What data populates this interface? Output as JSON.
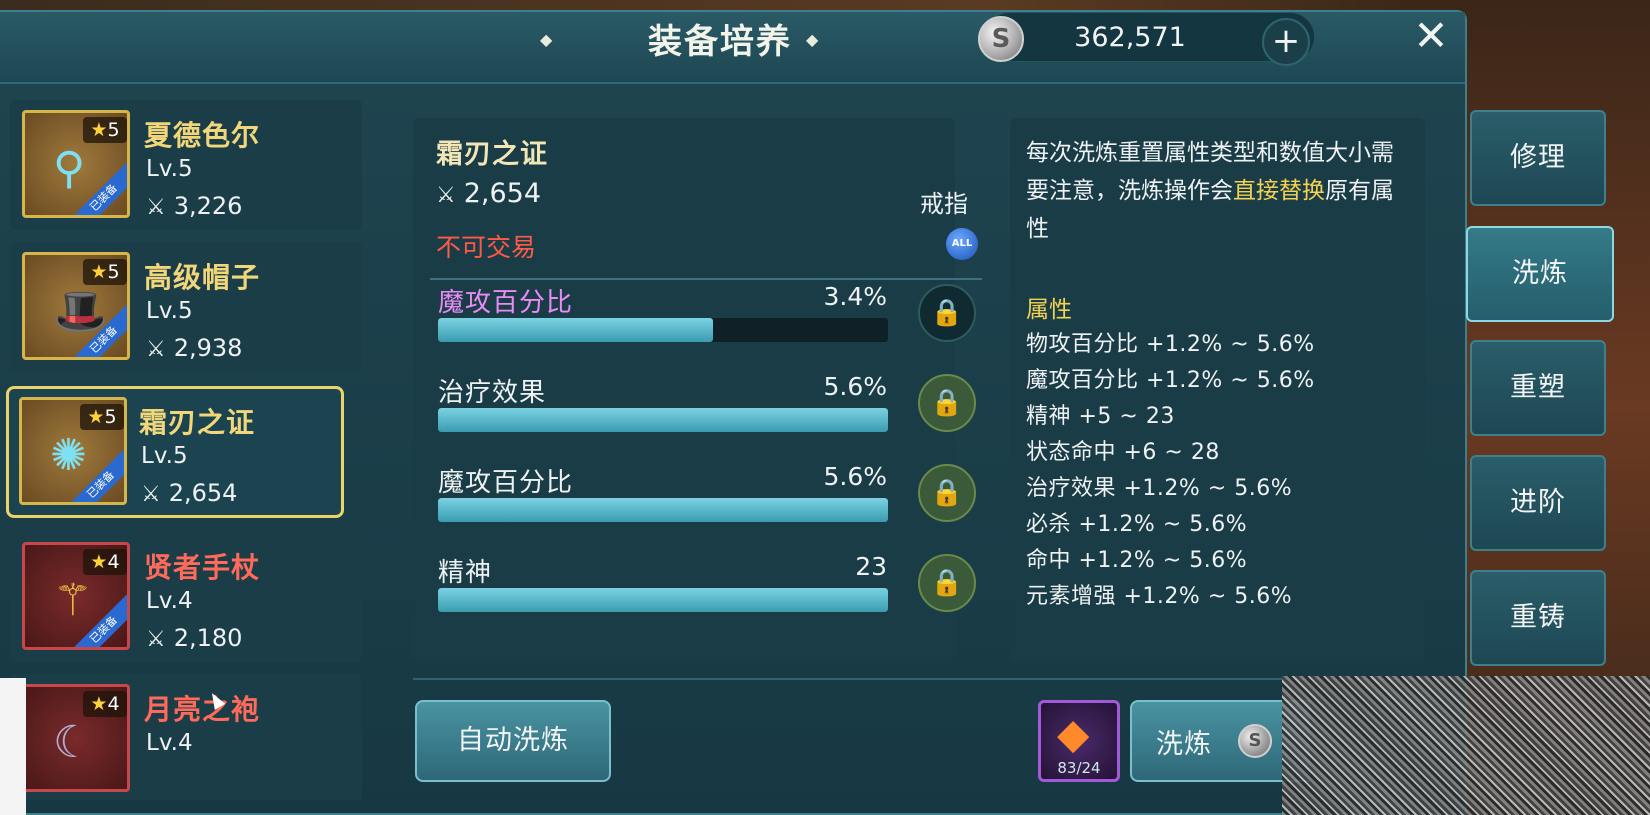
{
  "header": {
    "title": "装备培养",
    "currency_amount": "362,571",
    "add_label": "+",
    "close_label": "✕",
    "coin_glyph": "S"
  },
  "equipment_list": [
    {
      "name": "夏德色尔",
      "stars": "5",
      "level": "Lv.5",
      "power": "3,226",
      "icon": "earrings-icon",
      "rarity": "gold",
      "equipped_tag": "已装备"
    },
    {
      "name": "高级帽子",
      "stars": "5",
      "level": "Lv.5",
      "power": "2,938",
      "icon": "top-hat-icon",
      "rarity": "gold",
      "equipped_tag": "已装备"
    },
    {
      "name": "霜刃之证",
      "stars": "5",
      "level": "Lv.5",
      "power": "2,654",
      "icon": "frost-ring-icon",
      "rarity": "gold",
      "equipped_tag": "已装备",
      "selected": true
    },
    {
      "name": "贤者手杖",
      "stars": "4",
      "level": "Lv.4",
      "power": "2,180",
      "icon": "sage-staff-icon",
      "rarity": "red",
      "equipped_tag": "已装备"
    },
    {
      "name": "月亮之袍",
      "stars": "4",
      "level": "Lv.4",
      "power": "",
      "icon": "moon-robe-icon",
      "rarity": "red",
      "equipped_tag": ""
    }
  ],
  "detail": {
    "name": "霜刃之证",
    "power": "2,654",
    "tradable": "不可交易",
    "slot": "戒指",
    "slot_badge": "ALL",
    "attributes": [
      {
        "name": "魔攻百分比",
        "value": "3.4%",
        "fill": 0.61,
        "locked": false,
        "color": "#e98cf4"
      },
      {
        "name": "治疗效果",
        "value": "5.6%",
        "fill": 1.0,
        "locked": true,
        "color": "#eef2f2"
      },
      {
        "name": "魔攻百分比",
        "value": "5.6%",
        "fill": 1.0,
        "locked": true,
        "color": "#eef2f2"
      },
      {
        "name": "精神",
        "value": "23",
        "fill": 1.0,
        "locked": true,
        "color": "#eef2f2"
      }
    ]
  },
  "info": {
    "desc_part1": "每次洗炼重置属性类型和数值大小需要注意，洗炼操作会",
    "desc_highlight": "直接替换",
    "desc_part2": "原有属性",
    "ranges_title": "属性",
    "ranges": [
      "物攻百分比 +1.2% ~ 5.6%",
      "魔攻百分比 +1.2% ~ 5.6%",
      "精神 +5 ~ 23",
      "状态命中 +6 ~ 28",
      "治疗效果 +1.2% ~ 5.6%",
      "必杀 +1.2% ~ 5.6%",
      "命中 +1.2% ~ 5.6%",
      "元素增强 +1.2% ~ 5.6%"
    ]
  },
  "actions": {
    "auto_refine": "自动洗炼",
    "refine": "洗炼",
    "material_count": "83/24"
  },
  "side_tabs": [
    {
      "label": "修理",
      "active": false
    },
    {
      "label": "洗炼",
      "active": true
    },
    {
      "label": "重塑",
      "active": false
    },
    {
      "label": "进阶",
      "active": false
    },
    {
      "label": "重铸",
      "active": false
    }
  ],
  "colors": {
    "accent_gold": "#f4d252",
    "warning_red": "#ff5a48",
    "panel_teal": "#1a3c47",
    "bar_fill": "#3a9cb0"
  }
}
